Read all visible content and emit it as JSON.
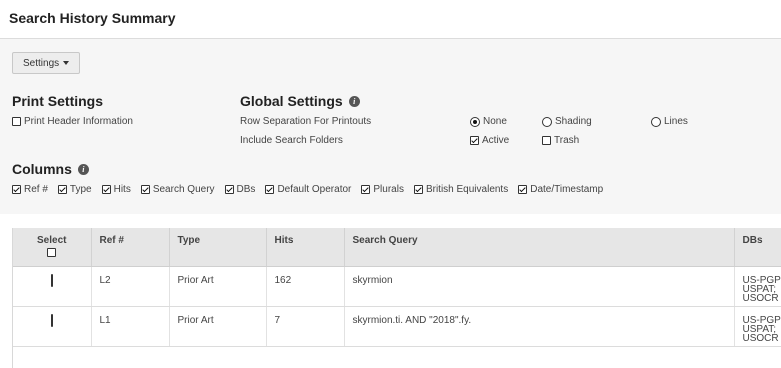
{
  "header": {
    "title": "Search History Summary"
  },
  "toolbar": {
    "settings_label": "Settings"
  },
  "print_settings": {
    "title": "Print Settings",
    "print_header": {
      "label": "Print Header Information",
      "checked": false
    }
  },
  "global_settings": {
    "title": "Global Settings",
    "row_separation": {
      "label": "Row Separation For Printouts",
      "options": [
        {
          "label": "None",
          "selected": true
        },
        {
          "label": "Shading",
          "selected": false
        },
        {
          "label": "Lines",
          "selected": false
        }
      ]
    },
    "include_folders": {
      "label": "Include Search Folders",
      "options": [
        {
          "label": "Active",
          "checked": true
        },
        {
          "label": "Trash",
          "checked": false
        }
      ]
    }
  },
  "columns": {
    "title": "Columns",
    "options": [
      {
        "label": "Ref #",
        "checked": true
      },
      {
        "label": "Type",
        "checked": true
      },
      {
        "label": "Hits",
        "checked": true
      },
      {
        "label": "Search Query",
        "checked": true
      },
      {
        "label": "DBs",
        "checked": true
      },
      {
        "label": "Default Operator",
        "checked": true
      },
      {
        "label": "Plurals",
        "checked": true
      },
      {
        "label": "British Equivalents",
        "checked": true
      },
      {
        "label": "Date/Timestamp",
        "checked": true
      }
    ]
  },
  "table": {
    "headers": {
      "select": "Select",
      "ref": "Ref #",
      "type": "Type",
      "hits": "Hits",
      "query": "Search Query",
      "dbs": "DBs"
    },
    "rows": [
      {
        "ref": "L2",
        "type": "Prior Art",
        "hits": "162",
        "query": "skyrmion",
        "dbs": "US-PGPUB;\nUSPAT;\nUSOCR",
        "selected": false
      },
      {
        "ref": "L1",
        "type": "Prior Art",
        "hits": "7",
        "query": "skyrmion.ti. AND \"2018\".fy.",
        "dbs": "US-PGPUB;\nUSPAT;\nUSOCR",
        "selected": false
      }
    ]
  }
}
